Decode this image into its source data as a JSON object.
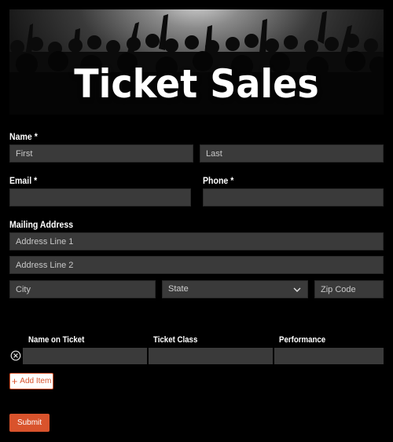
{
  "banner": {
    "title": "Ticket Sales"
  },
  "form": {
    "name": {
      "label": "Name *",
      "first_placeholder": "First",
      "last_placeholder": "Last"
    },
    "email": {
      "label": "Email *"
    },
    "phone": {
      "label": "Phone *"
    },
    "address": {
      "label": "Mailing Address",
      "line1_placeholder": "Address Line 1",
      "line2_placeholder": "Address Line 2",
      "city_placeholder": "City",
      "state_value": "State",
      "zip_placeholder": "Zip Code"
    },
    "tickets": {
      "columns": [
        "Name on Ticket",
        "Ticket Class",
        "Performance"
      ],
      "add_item_label": "Add Item"
    },
    "submit_label": "Submit"
  },
  "colors": {
    "accent": "#d9532c",
    "field_bg": "#3a3a3a",
    "page_bg": "#000000"
  }
}
